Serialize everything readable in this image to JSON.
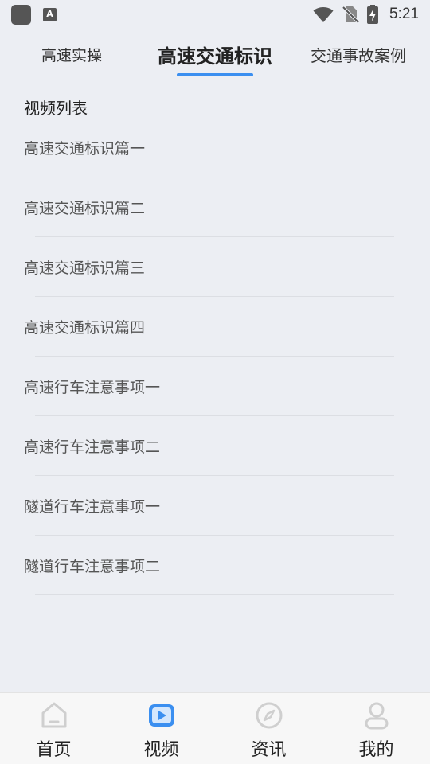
{
  "status_bar": {
    "time": "5:21",
    "keyboard_badge": "A"
  },
  "tabs": [
    {
      "label": "高速实操"
    },
    {
      "label": "高速交通标识"
    },
    {
      "label": "交通事故案例"
    }
  ],
  "active_tab": "高速交通标识",
  "section": {
    "title": "视频列表"
  },
  "videos": [
    {
      "title": "高速交通标识篇一"
    },
    {
      "title": "高速交通标识篇二"
    },
    {
      "title": "高速交通标识篇三"
    },
    {
      "title": "高速交通标识篇四"
    },
    {
      "title": "高速行车注意事项一"
    },
    {
      "title": "高速行车注意事项二"
    },
    {
      "title": "隧道行车注意事项一"
    },
    {
      "title": "隧道行车注意事项二"
    }
  ],
  "bottom_nav": [
    {
      "label": "首页",
      "icon": "home-icon"
    },
    {
      "label": "视频",
      "icon": "video-icon"
    },
    {
      "label": "资讯",
      "icon": "compass-icon"
    },
    {
      "label": "我的",
      "icon": "profile-icon"
    }
  ],
  "active_nav": "视频",
  "colors": {
    "accent": "#3b8ff0",
    "background": "#eceef3",
    "nav_inactive_icon": "#cfcfcf"
  }
}
